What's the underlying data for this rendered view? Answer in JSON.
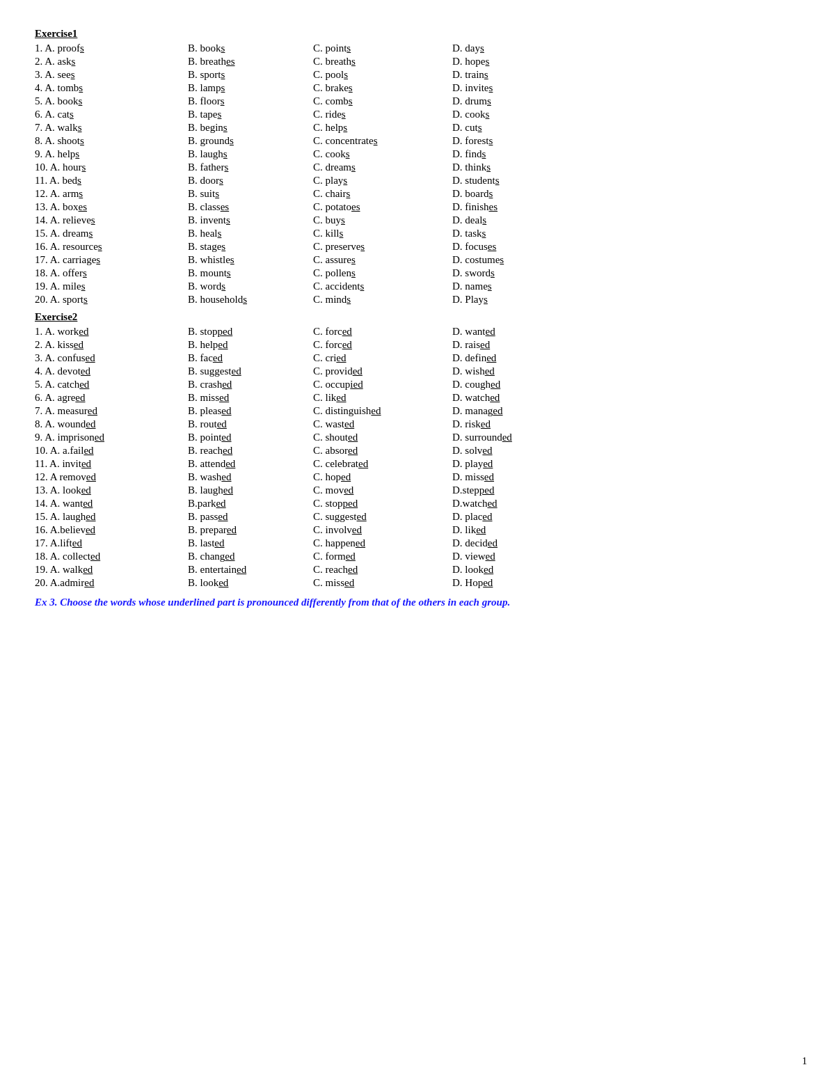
{
  "exercise1": {
    "title": "Exercise1",
    "rows": [
      {
        "a": "1. A. proof<u>s</u>",
        "b": "B. book<u>s</u>",
        "c": "C. point<u>s</u>",
        "d": "D. day<u>s</u>"
      },
      {
        "a": "2. A. ask<u>s</u>",
        "b": "B. breath<u>es</u>",
        "c": "C. breath<u>s</u>",
        "d": "D. hope<u>s</u>"
      },
      {
        "a": "3. A. see<u>s</u>",
        "b": "B. sport<u>s</u>",
        "c": "C. pool<u>s</u>",
        "d": "D. train<u>s</u>"
      },
      {
        "a": "4. A. tomb<u>s</u>",
        "b": "B. lamp<u>s</u>",
        "c": "C. brake<u>s</u>",
        "d": "D. invite<u>s</u>"
      },
      {
        "a": "5. A. book<u>s</u>",
        "b": "B. floor<u>s</u>",
        "c": "C. comb<u>s</u>",
        "d": "D. drum<u>s</u>"
      },
      {
        "a": "6. A. cat<u>s</u>",
        "b": "B. tape<u>s</u>",
        "c": "C. ride<u>s</u>",
        "d": "D. cook<u>s</u>"
      },
      {
        "a": "7. A. walk<u>s</u>",
        "b": "B. begin<u>s</u>",
        "c": "C. help<u>s</u>",
        "d": "D. cut<u>s</u>"
      },
      {
        "a": "8. A. shoot<u>s</u>",
        "b": "B. ground<u>s</u>",
        "c": "C. concentrate<u>s</u>",
        "d": "D. forest<u>s</u>"
      },
      {
        "a": "9. A. help<u>s</u>",
        "b": "B. laugh<u>s</u>",
        "c": "C. cook<u>s</u>",
        "d": "D. find<u>s</u>"
      },
      {
        "a": "10. A. hour<u>s</u>",
        "b": "B. father<u>s</u>",
        "c": "C. dream<u>s</u>",
        "d": "D. think<u>s</u>"
      },
      {
        "a": "11. A. bed<u>s</u>",
        "b": "B. door<u>s</u>",
        "c": "C. play<u>s</u>",
        "d": "D. student<u>s</u>"
      },
      {
        "a": "12. A. arm<u>s</u>",
        "b": "B. suit<u>s</u>",
        "c": "C. chair<u>s</u>",
        "d": "D. board<u>s</u>"
      },
      {
        "a": "13. A. box<u>es</u>",
        "b": "B. class<u>es</u>",
        "c": "C. potato<u>es</u>",
        "d": "D. finish<u>es</u>"
      },
      {
        "a": "14. A. relieve<u>s</u>",
        "b": "B. invent<u>s</u>",
        "c": "C. buy<u>s</u>",
        "d": "D. deal<u>s</u>"
      },
      {
        "a": "15. A. dream<u>s</u>",
        "b": "B. heal<u>s</u>",
        "c": "C. kill<u>s</u>",
        "d": "D. task<u>s</u>"
      },
      {
        "a": "16. A. resource<u>s</u>",
        "b": "B. stage<u>s</u>",
        "c": "C. preserve<u>s</u>",
        "d": "D. focus<u>es</u>"
      },
      {
        "a": "17. A. carriage<u>s</u>",
        "b": "B. whistle<u>s</u>",
        "c": "C. assure<u>s</u>",
        "d": "D. costume<u>s</u>"
      },
      {
        "a": "18. A. offer<u>s</u>",
        "b": "B. mount<u>s</u>",
        "c": "C. pollen<u>s</u>",
        "d": "D. sword<u>s</u>"
      },
      {
        "a": "19. A. mile<u>s</u>",
        "b": "B. word<u>s</u>",
        "c": "C. accident<u>s</u>",
        "d": "D. name<u>s</u>"
      },
      {
        "a": "20. A. sport<u>s</u>",
        "b": "B. household<u>s</u>",
        "c": "C. mind<u>s</u>",
        "d": "D. Play<u>s</u>"
      }
    ]
  },
  "exercise2": {
    "title": "Exercise2",
    "rows": [
      {
        "a": "1. A. work<u>ed</u>",
        "b": "B. stop<u>ped</u>",
        "c": "C. forc<u>ed</u>",
        "d": "D. want<u>ed</u>"
      },
      {
        "a": "2. A. kiss<u>ed</u>",
        "b": "B. help<u>ed</u>",
        "c": "C. forc<u>ed</u>",
        "d": "D. rais<u>ed</u>"
      },
      {
        "a": "3. A. confus<u>ed</u>",
        "b": "B. fac<u>ed</u>",
        "c": "C. cri<u>ed</u>",
        "d": "D. defin<u>ed</u>"
      },
      {
        "a": "4. A. devot<u>ed</u>",
        "b": "B. suggest<u>ed</u>",
        "c": "C. provid<u>ed</u>",
        "d": "D. wish<u>ed</u>"
      },
      {
        "a": "5. A. catch<u>ed</u>",
        "b": "B. crash<u>ed</u>",
        "c": "C. occup<u>ied</u>",
        "d": "D. cough<u>ed</u>"
      },
      {
        "a": "6. A. agre<u>ed</u>",
        "b": "B. miss<u>ed</u>",
        "c": "C. lik<u>ed</u>",
        "d": "D. watch<u>ed</u>"
      },
      {
        "a": "7. A. measur<u>ed</u>",
        "b": "B. pleas<u>ed</u>",
        "c": "C. distinguish<u>ed</u>",
        "d": "D. manag<u>ed</u>"
      },
      {
        "a": "8. A. wound<u>ed</u>",
        "b": "B. rout<u>ed</u>",
        "c": "C. wast<u>ed</u>",
        "d": "D. risk<u>ed</u>"
      },
      {
        "a": "9. A. imprison<u>ed</u>",
        "b": "B. point<u>ed</u>",
        "c": "C. shout<u>ed</u>",
        "d": "D. surround<u>ed</u>"
      },
      {
        "a": "10. A. a.fail<u>ed</u>",
        "b": "B. reach<u>ed</u>",
        "c": "C. absor<u>ed</u>",
        "d": "D. solv<u>ed</u>"
      },
      {
        "a": "11. A. invit<u>ed</u>",
        "b": "B. attend<u>ed</u>",
        "c": "C. celebrat<u>ed</u>",
        "d": "D. play<u>ed</u>"
      },
      {
        "a": "12. A remov<u>ed</u>",
        "b": "B. wash<u>ed</u>",
        "c": "C. hop<u>ed</u>",
        "d": "D. miss<u>ed</u>"
      },
      {
        "a": "13. A. look<u>ed</u>",
        "b": "B. laugh<u>ed</u>",
        "c": "C. mov<u>ed</u>",
        "d": "D.step<u>ped</u>"
      },
      {
        "a": "14. A. want<u>ed</u>",
        "b": "B.park<u>ed</u>",
        "c": "C. stop<u>ped</u>",
        "d": "D.watch<u>ed</u>"
      },
      {
        "a": "15. A. laugh<u>ed</u>",
        "b": "B. pass<u>ed</u>",
        "c": "C. suggest<u>ed</u>",
        "d": "D. plac<u>ed</u>"
      },
      {
        "a": "16. A.believ<u>ed</u>",
        "b": "B. prepar<u>ed</u>",
        "c": "C. involv<u>ed</u>",
        "d": "D. lik<u>ed</u>"
      },
      {
        "a": "17. A.lift<u>ed</u>",
        "b": "B. last<u>ed</u>",
        "c": "C. happen<u>ed</u>",
        "d": "D. decid<u>ed</u>"
      },
      {
        "a": "18. A. collect<u>ed</u>",
        "b": "B. chang<u>ed</u>",
        "c": "C. form<u>ed</u>",
        "d": "D. view<u>ed</u>"
      },
      {
        "a": "19. A. walk<u>ed</u>",
        "b": "B. entertain<u>ed</u>",
        "c": "C. reach<u>ed</u>",
        "d": "D. look<u>ed</u>"
      },
      {
        "a": "20. A.admir<u>ed</u>",
        "b": "B. look<u>ed</u>",
        "c": "C. miss<u>ed</u>",
        "d": "D. Hop<u>ed</u>"
      }
    ]
  },
  "ex3_instruction": "Ex 3. Choose the words whose underlined part is pronounced differently from that of the others in each group.",
  "page_number": "1"
}
